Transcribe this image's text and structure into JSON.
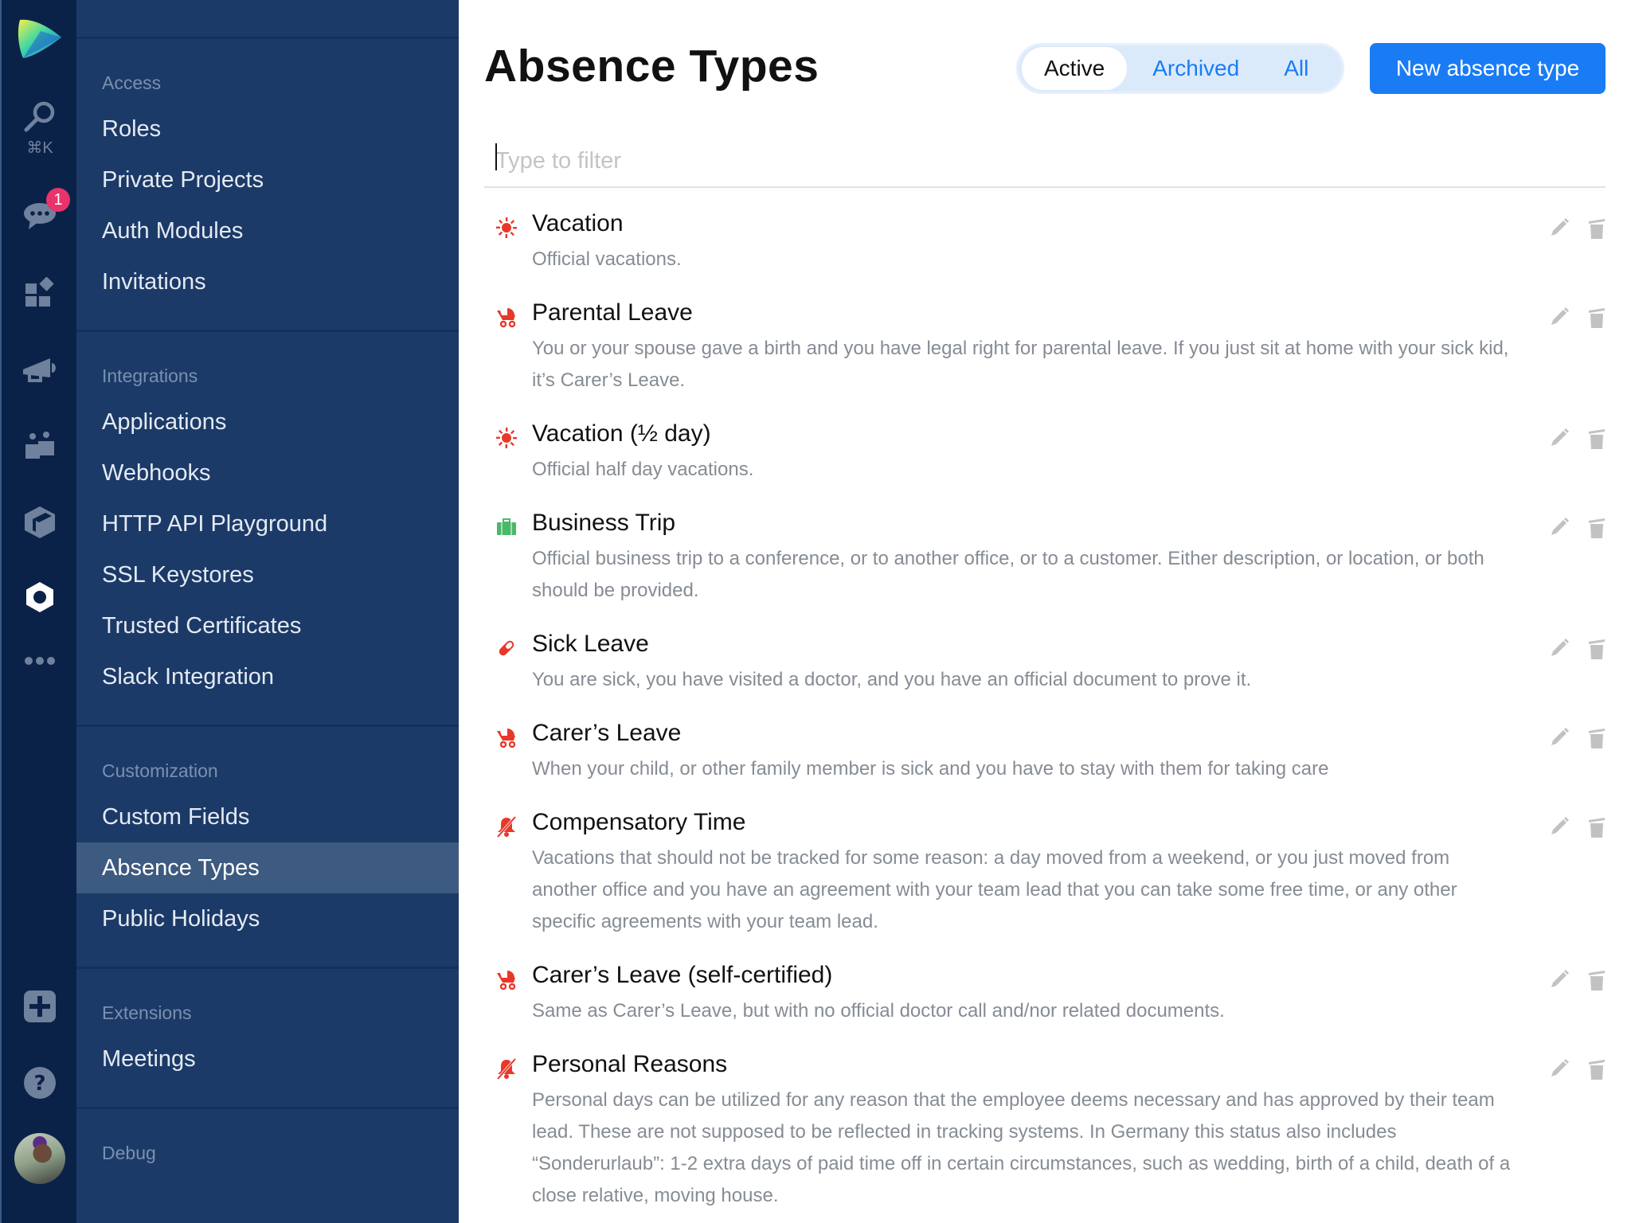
{
  "rail": {
    "logo": "app-logo",
    "search_hint": "⌘K",
    "chat_badge": "1",
    "items": [
      {
        "name": "search-icon"
      },
      {
        "name": "chat-icon"
      },
      {
        "name": "apps-icon"
      },
      {
        "name": "megaphone-icon"
      },
      {
        "name": "team-icon"
      },
      {
        "name": "package-icon"
      },
      {
        "name": "settings-icon"
      },
      {
        "name": "more-icon"
      },
      {
        "name": "add-icon"
      },
      {
        "name": "help-icon"
      },
      {
        "name": "avatar"
      }
    ]
  },
  "sidebar": {
    "sections": [
      {
        "heading": "Access",
        "items": [
          "Roles",
          "Private Projects",
          "Auth Modules",
          "Invitations"
        ]
      },
      {
        "heading": "Integrations",
        "items": [
          "Applications",
          "Webhooks",
          "HTTP API Playground",
          "SSL Keystores",
          "Trusted Certificates",
          "Slack Integration"
        ]
      },
      {
        "heading": "Customization",
        "items": [
          "Custom Fields",
          "Absence Types",
          "Public Holidays"
        ]
      },
      {
        "heading": "Extensions",
        "items": [
          "Meetings"
        ]
      },
      {
        "heading": "Debug",
        "items": []
      }
    ],
    "active_item": "Absence Types"
  },
  "main": {
    "title": "Absence Types",
    "tabs": [
      {
        "label": "Active",
        "active": true
      },
      {
        "label": "Archived",
        "active": false
      },
      {
        "label": "All",
        "active": false
      }
    ],
    "new_button": "New absence type",
    "filter_placeholder": "Type to filter",
    "colors": {
      "accent": "#1a7cf5",
      "icon_red": "#e8382a",
      "icon_green": "#4cb86a",
      "action_gray": "#c2c2c2"
    },
    "absence_types": [
      {
        "name": "Vacation",
        "icon": "sun-icon",
        "color": "#e8382a",
        "description": "Official vacations."
      },
      {
        "name": "Parental Leave",
        "icon": "stroller-icon",
        "color": "#e8382a",
        "description": "You or your spouse gave a birth and you have legal right for parental leave. If you just sit at home with your sick kid, it’s Carer’s Leave."
      },
      {
        "name": "Vacation (½ day)",
        "icon": "sun-icon",
        "color": "#e8382a",
        "description": "Official half day vacations."
      },
      {
        "name": "Business Trip",
        "icon": "briefcase-icon",
        "color": "#4cb86a",
        "description": "Official business trip to a conference, or to another office, or to a customer. Either description, or location, or both should be provided."
      },
      {
        "name": "Sick Leave",
        "icon": "pill-icon",
        "color": "#e8382a",
        "description": "You are sick, you have visited a doctor, and you have an official document to prove it."
      },
      {
        "name": "Carer’s Leave",
        "icon": "stroller-icon",
        "color": "#e8382a",
        "description": "When your child, or other family member is sick and you have to stay with them for taking care"
      },
      {
        "name": "Compensatory Time",
        "icon": "bell-slash-icon",
        "color": "#e8382a",
        "description": "Vacations that should not be tracked for some reason: a day moved from a weekend, or you just moved from another office and you have an agreement with your team lead that you can take some free time, or any other specific agreements with your team lead."
      },
      {
        "name": "Carer’s Leave (self-certified)",
        "icon": "stroller-icon",
        "color": "#e8382a",
        "description": "Same as Carer’s Leave, but with no official doctor call and/nor related documents."
      },
      {
        "name": "Personal Reasons",
        "icon": "bell-slash-icon",
        "color": "#e8382a",
        "description": "Personal days can be utilized for any reason that the employee deems necessary and has approved by their team lead. These are not supposed to be reflected in tracking systems. In Germany this status also includes “Sonderurlaub”: 1-2 extra days of paid time off in certain circumstances, such as wedding, birth of a child, death of a close relative, moving house."
      }
    ]
  }
}
